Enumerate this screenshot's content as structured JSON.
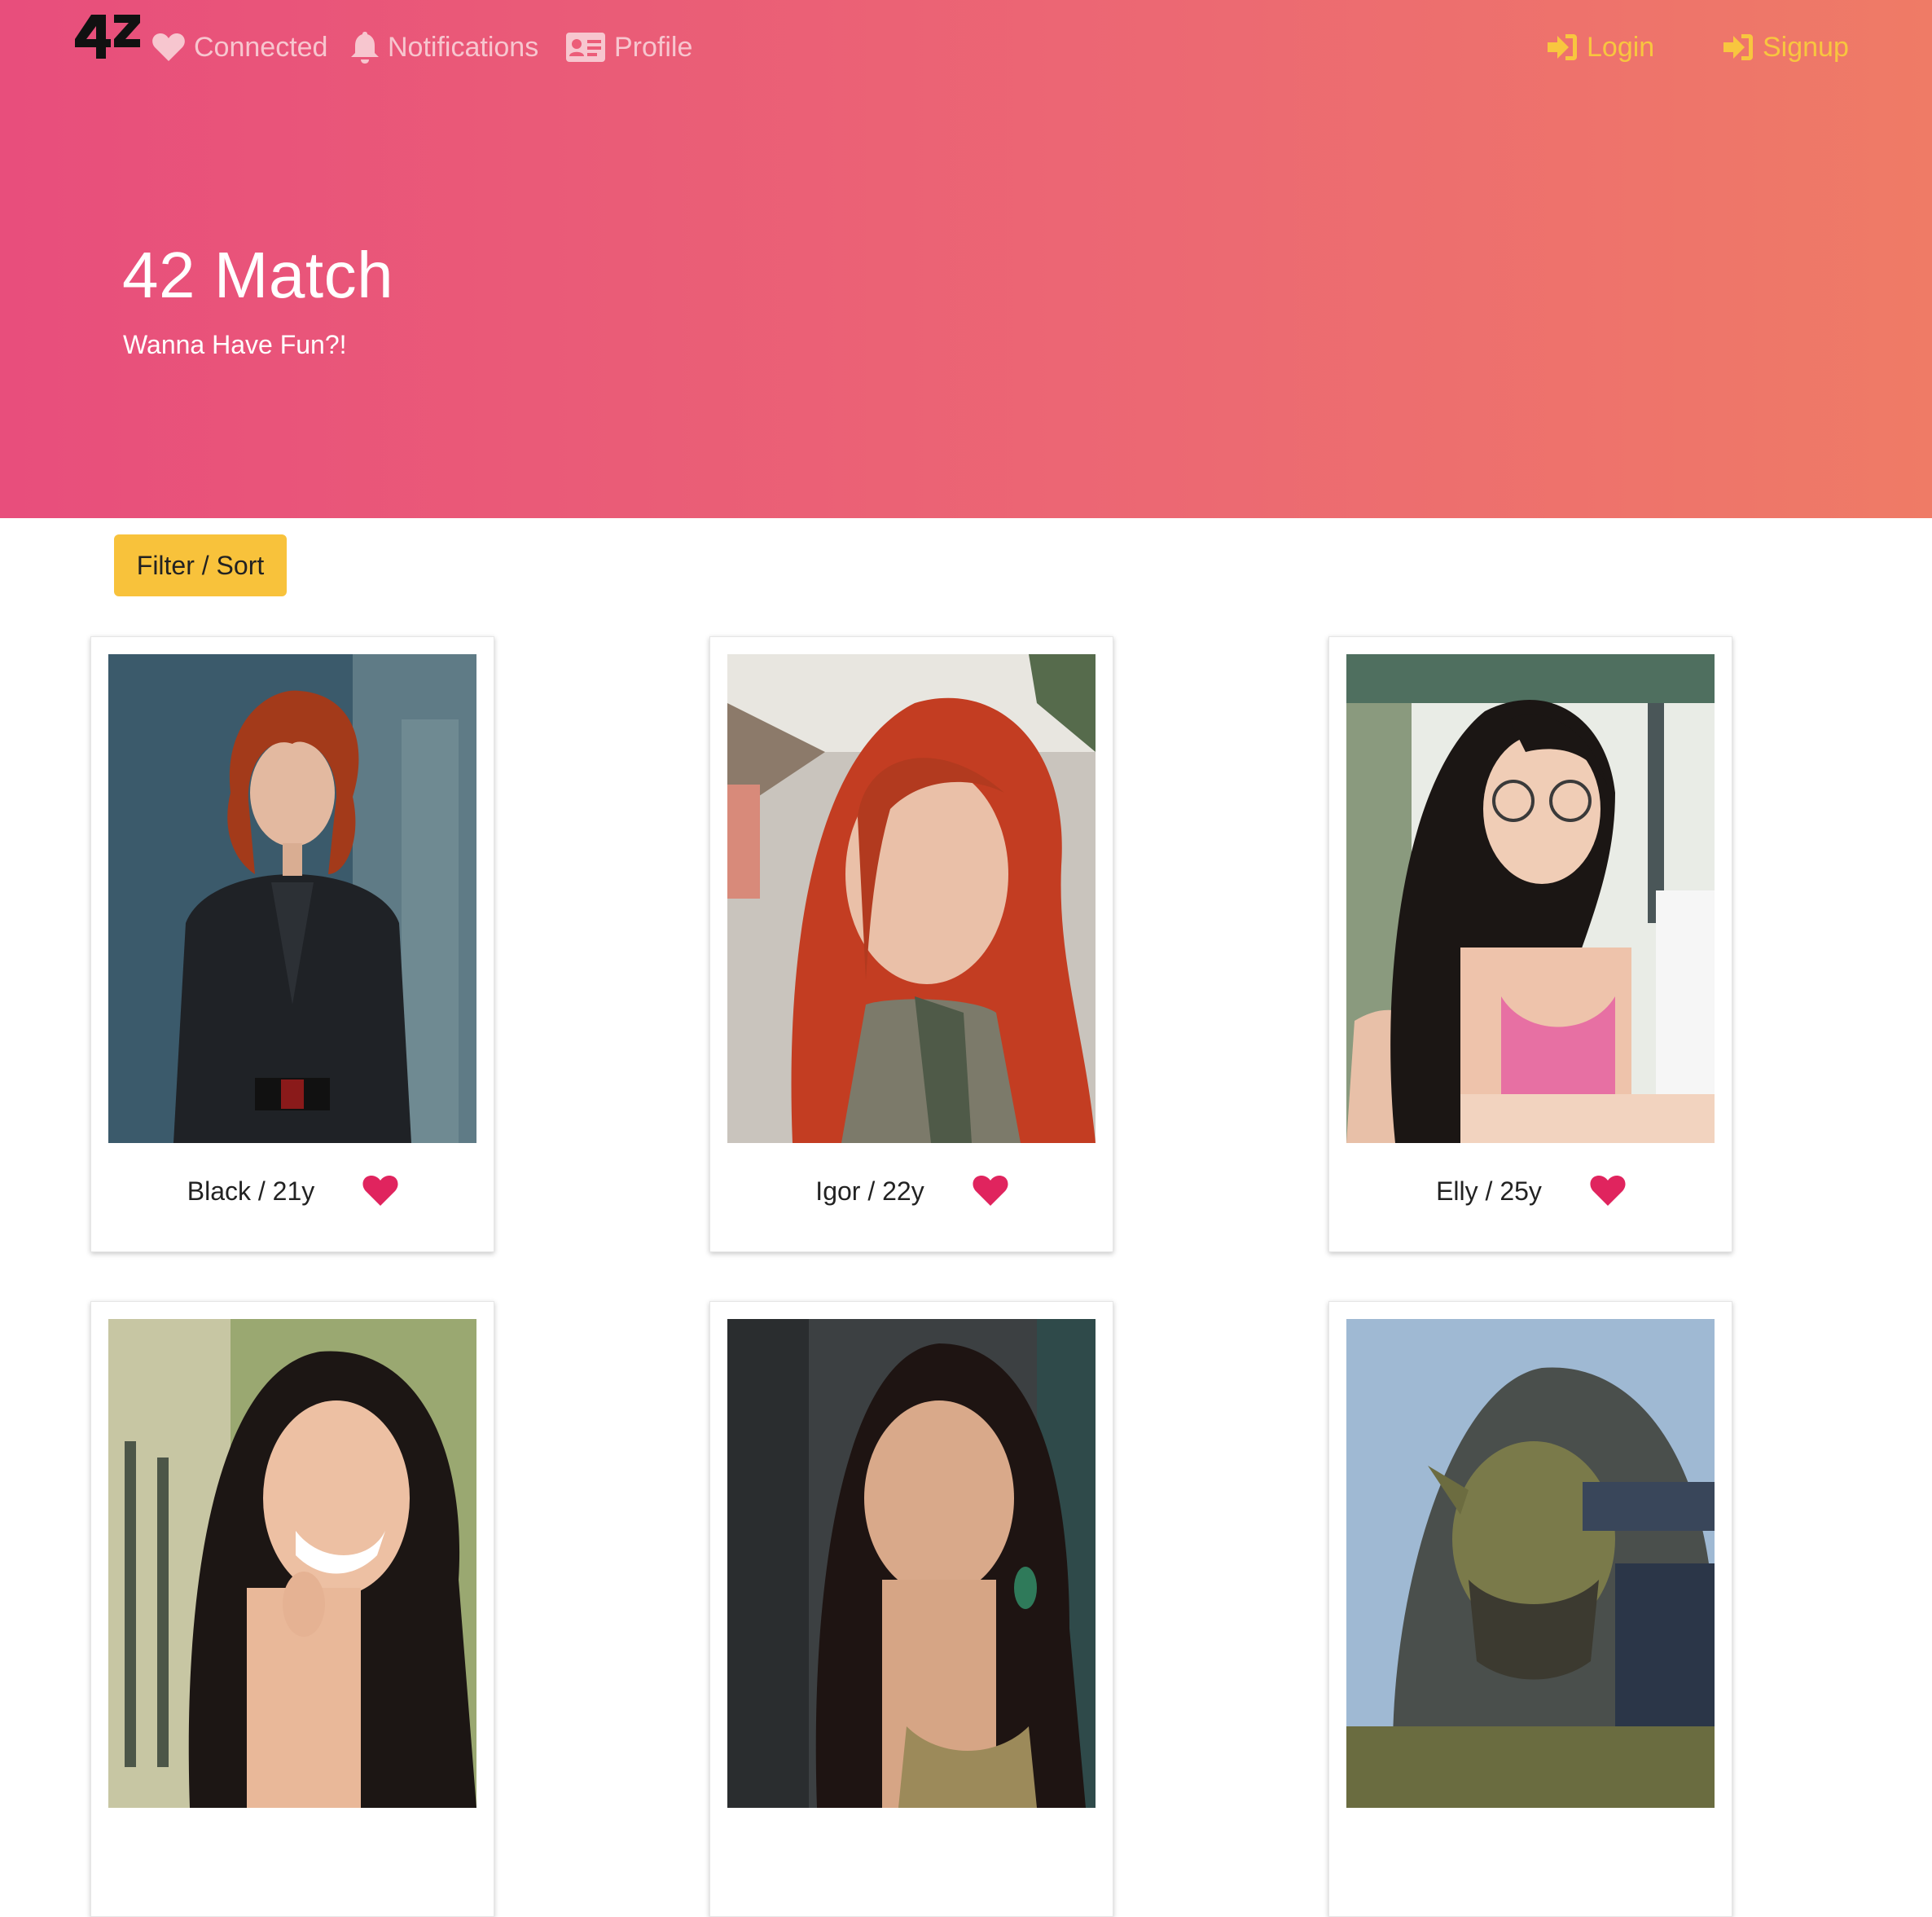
{
  "nav": {
    "connected": "Connected",
    "notifications": "Notifications",
    "profile": "Profile",
    "login": "Login",
    "signup": "Signup",
    "logo_icon": "42-logo",
    "muted_color": "#f7c6cf",
    "accent_color": "#f8c63f"
  },
  "hero": {
    "title": "42 Match",
    "subtitle": "Wanna Have Fun?!"
  },
  "filter": {
    "label": "Filter / Sort",
    "color": "#f8c23b"
  },
  "cards": [
    {
      "caption": "Black / 21y"
    },
    {
      "caption": "Igor / 22y"
    },
    {
      "caption": "Elly / 25y"
    },
    {
      "caption": ""
    },
    {
      "caption": ""
    },
    {
      "caption": ""
    }
  ],
  "like_color": "#e0245e"
}
